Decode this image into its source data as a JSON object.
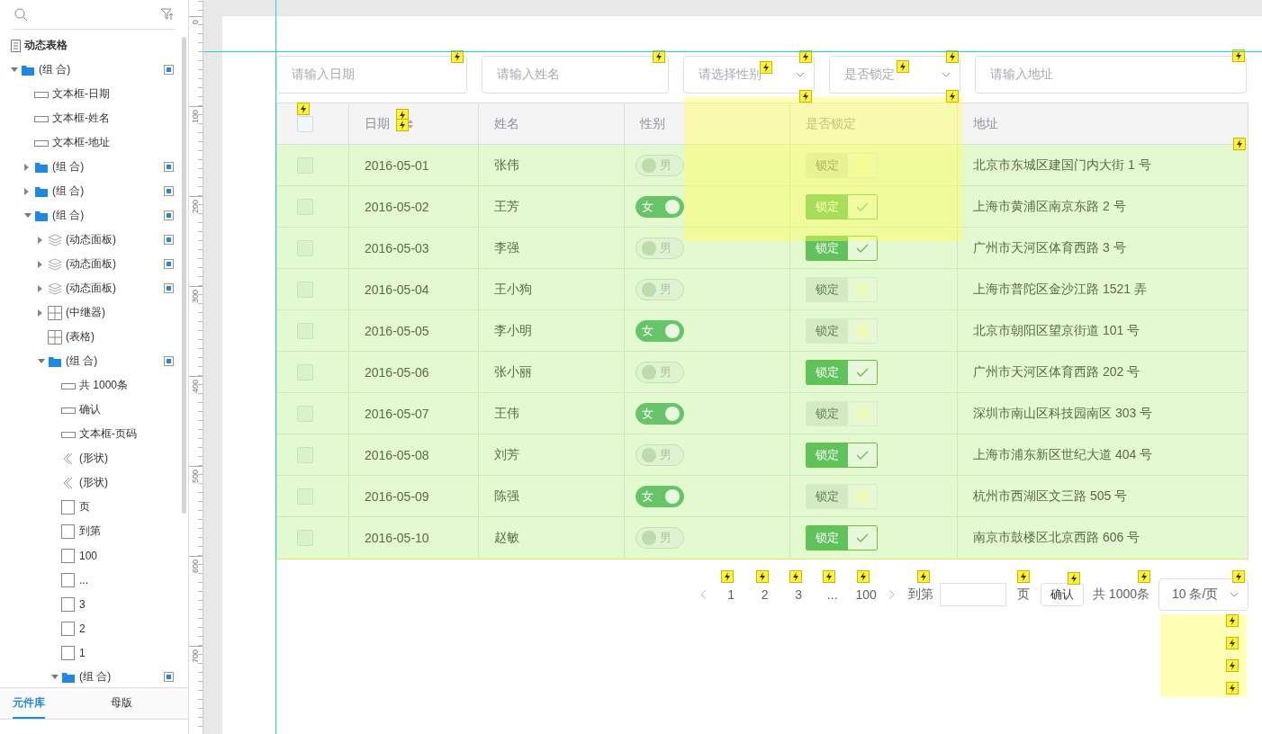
{
  "outline_panel": {
    "page_title": "动态表格",
    "items": [
      {
        "label": "(组 合)",
        "kind": "group",
        "expandable": true,
        "expanded": true,
        "marker": true,
        "children": [
          {
            "label": "文本框-日期",
            "kind": "textbox",
            "expandable": false,
            "marker": false
          },
          {
            "label": "文本框-姓名",
            "kind": "textbox",
            "expandable": false,
            "marker": false
          },
          {
            "label": "文本框-地址",
            "kind": "textbox",
            "expandable": false,
            "marker": false
          },
          {
            "label": "(组 合)",
            "kind": "group",
            "expandable": true,
            "expanded": false,
            "marker": true
          },
          {
            "label": "(组 合)",
            "kind": "group",
            "expandable": true,
            "expanded": false,
            "marker": true
          },
          {
            "label": "(组 合)",
            "kind": "group",
            "expandable": true,
            "expanded": true,
            "marker": true,
            "children": [
              {
                "label": "(动态面板)",
                "kind": "panel",
                "expandable": true,
                "expanded": false,
                "marker": true
              },
              {
                "label": "(动态面板)",
                "kind": "panel",
                "expandable": true,
                "expanded": false,
                "marker": true
              },
              {
                "label": "(动态面板)",
                "kind": "panel",
                "expandable": true,
                "expanded": false,
                "marker": true
              },
              {
                "label": "(中继器)",
                "kind": "grid",
                "expandable": true,
                "expanded": false,
                "marker": false
              },
              {
                "label": "(表格)",
                "kind": "grid",
                "expandable": false,
                "marker": false
              },
              {
                "label": "(组 合)",
                "kind": "group",
                "expandable": true,
                "expanded": true,
                "marker": true,
                "children": [
                  {
                    "label": "共 1000条",
                    "kind": "textbox",
                    "expandable": false,
                    "marker": false
                  },
                  {
                    "label": "确认",
                    "kind": "textbox",
                    "expandable": false,
                    "marker": false
                  },
                  {
                    "label": "文本框-页码",
                    "kind": "textbox",
                    "expandable": false,
                    "marker": false
                  },
                  {
                    "label": "(形状)",
                    "kind": "shape",
                    "expandable": false,
                    "marker": false
                  },
                  {
                    "label": "(形状)",
                    "kind": "shape",
                    "expandable": false,
                    "marker": false
                  },
                  {
                    "label": "页",
                    "kind": "rect",
                    "expandable": false,
                    "marker": false
                  },
                  {
                    "label": "到第",
                    "kind": "rect",
                    "expandable": false,
                    "marker": false
                  },
                  {
                    "label": "100",
                    "kind": "rect",
                    "expandable": false,
                    "marker": false
                  },
                  {
                    "label": "...",
                    "kind": "rect",
                    "expandable": false,
                    "marker": false
                  },
                  {
                    "label": "3",
                    "kind": "rect",
                    "expandable": false,
                    "marker": false
                  },
                  {
                    "label": "2",
                    "kind": "rect",
                    "expandable": false,
                    "marker": false
                  },
                  {
                    "label": "1",
                    "kind": "rect",
                    "expandable": false,
                    "marker": false
                  },
                  {
                    "label": "(组 合)",
                    "kind": "group",
                    "expandable": true,
                    "expanded": true,
                    "marker": true
                  }
                ]
              }
            ]
          }
        ]
      }
    ],
    "tabs": [
      {
        "label": "元件库",
        "selected": true
      },
      {
        "label": "母版",
        "selected": false
      }
    ]
  },
  "ruler": {
    "labels": [
      "0",
      "100",
      "200",
      "300",
      "400",
      "500",
      "600",
      "700"
    ]
  },
  "filters": [
    {
      "kind": "input",
      "placeholder": "请输入日期"
    },
    {
      "kind": "input",
      "placeholder": "请输入姓名"
    },
    {
      "kind": "select",
      "placeholder": "请选择性别"
    },
    {
      "kind": "select",
      "placeholder": "是否锁定"
    },
    {
      "kind": "input",
      "placeholder": "请输入地址"
    }
  ],
  "table": {
    "header_checked": false,
    "columns": [
      "日期",
      "姓名",
      "性别",
      "是否锁定",
      "地址"
    ],
    "rows": [
      {
        "checked": false,
        "date": "2016-05-01",
        "name": "张伟",
        "gender": "男",
        "female": false,
        "lock_label": "锁定",
        "locked": false,
        "address": "北京市东城区建国门内大街 1 号"
      },
      {
        "checked": false,
        "date": "2016-05-02",
        "name": "王芳",
        "gender": "女",
        "female": true,
        "lock_label": "锁定",
        "locked": true,
        "address": "上海市黄浦区南京东路 2 号"
      },
      {
        "checked": false,
        "date": "2016-05-03",
        "name": "李强",
        "gender": "男",
        "female": false,
        "lock_label": "锁定",
        "locked": true,
        "address": "广州市天河区体育西路 3 号"
      },
      {
        "checked": false,
        "date": "2016-05-04",
        "name": "王小狗",
        "gender": "男",
        "female": false,
        "lock_label": "锁定",
        "locked": false,
        "address": "上海市普陀区金沙江路 1521 弄"
      },
      {
        "checked": false,
        "date": "2016-05-05",
        "name": "李小明",
        "gender": "女",
        "female": true,
        "lock_label": "锁定",
        "locked": false,
        "address": "北京市朝阳区望京街道 101 号"
      },
      {
        "checked": false,
        "date": "2016-05-06",
        "name": "张小丽",
        "gender": "男",
        "female": false,
        "lock_label": "锁定",
        "locked": true,
        "address": "广州市天河区体育西路 202 号"
      },
      {
        "checked": false,
        "date": "2016-05-07",
        "name": "王伟",
        "gender": "女",
        "female": true,
        "lock_label": "锁定",
        "locked": false,
        "address": "深圳市南山区科技园南区 303 号"
      },
      {
        "checked": false,
        "date": "2016-05-08",
        "name": "刘芳",
        "gender": "男",
        "female": false,
        "lock_label": "锁定",
        "locked": true,
        "address": "上海市浦东新区世纪大道 404 号"
      },
      {
        "checked": false,
        "date": "2016-05-09",
        "name": "陈强",
        "gender": "女",
        "female": true,
        "lock_label": "锁定",
        "locked": false,
        "address": "杭州市西湖区文三路 505 号"
      },
      {
        "checked": false,
        "date": "2016-05-10",
        "name": "赵敏",
        "gender": "男",
        "female": false,
        "lock_label": "锁定",
        "locked": true,
        "address": "南京市鼓楼区北京西路 606 号"
      }
    ]
  },
  "pagination": {
    "pages": [
      "1",
      "2",
      "3",
      "...",
      "100"
    ],
    "goto_label": "到第",
    "page_suffix": "页",
    "confirm": "确认",
    "total": "共 1000条",
    "page_size": "10 条/页"
  }
}
